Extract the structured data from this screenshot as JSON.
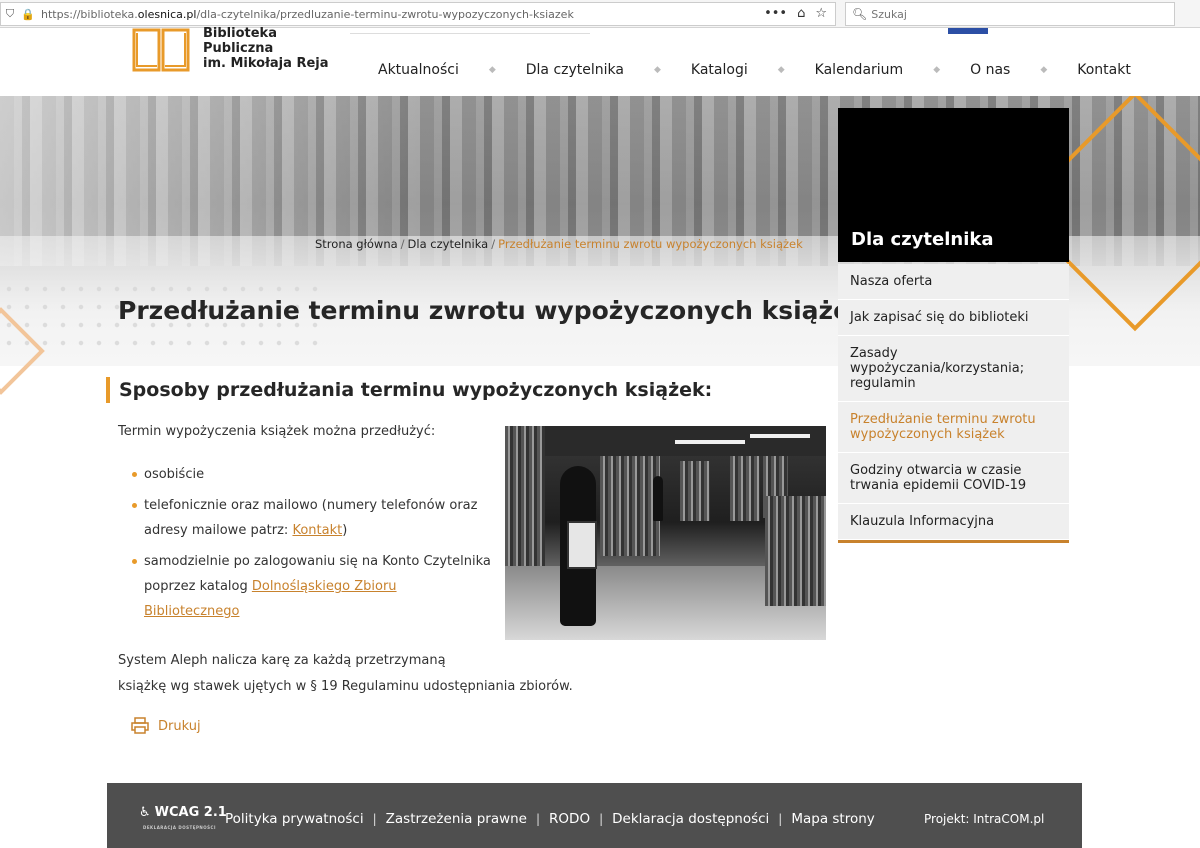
{
  "browser": {
    "url_prefix": "https://biblioteka.",
    "url_domain": "olesnica.pl",
    "url_path": "/dla-czytelnika/przedluzanie-terminu-zwrotu-wypozyczonych-ksiazek",
    "menu_dots": "•••",
    "search_placeholder": "Szukaj"
  },
  "logo": {
    "line1": "Biblioteka",
    "line2": "Publiczna",
    "line3": "im. Mikołaja Reja"
  },
  "nav": [
    "Aktualności",
    "Dla czytelnika",
    "Katalogi",
    "Kalendarium",
    "O nas",
    "Kontakt"
  ],
  "breadcrumb": {
    "home": "Strona główna",
    "section": "Dla czytelnika",
    "current": "Przedłużanie terminu zwrotu wypożyczonych książek"
  },
  "page_title": "Przedłużanie terminu zwrotu wypożyczonych książek",
  "sidebar": {
    "title": "Dla czytelnika",
    "items": [
      "Nasza oferta",
      "Jak zapisać się do biblioteki",
      "Zasady wypożyczania/korzystania; regulamin",
      "Przedłużanie terminu zwrotu wypożyczonych książek",
      "Godziny otwarcia w czasie trwania epidemii COVID-19",
      "Klauzula Informacyjna"
    ]
  },
  "content": {
    "subheading": "Sposoby przedłużania terminu wypożyczonych książek:",
    "intro": "Termin wypożyczenia książek można przedłużyć:",
    "bullet1": "osobiście",
    "bullet2_text": "telefonicznie oraz mailowo (numery telefonów oraz adresy mailowe patrz: ",
    "bullet2_link": "Kontakt",
    "bullet2_end": ")",
    "bullet3_text": "samodzielnie po zalogowaniu się na Konto Czytelnika poprzez katalog ",
    "bullet3_link": "Dolnośląskiego Zbioru Bibliotecznego",
    "para_line1": "System Aleph nalicza karę za każdą przetrzymaną",
    "para_line2": "książkę wg stawek ujętych w § 19 Regulaminu udostępniania zbiorów.",
    "print": "Drukuj"
  },
  "footer": {
    "wcag": "WCAG 2.1",
    "wcag_sub": "DEKLARACJA DOSTĘPNOŚCI",
    "links": [
      "Polityka prywatności",
      "Zastrzeżenia prawne",
      "RODO",
      "Deklaracja dostępności",
      "Mapa strony"
    ],
    "project": "Projekt: IntraCOM.pl"
  },
  "colors": {
    "accent": "#c8822d",
    "orange": "#e89a2a",
    "footer_bg": "#4f4f4f",
    "sidebar_head": "#000000"
  }
}
